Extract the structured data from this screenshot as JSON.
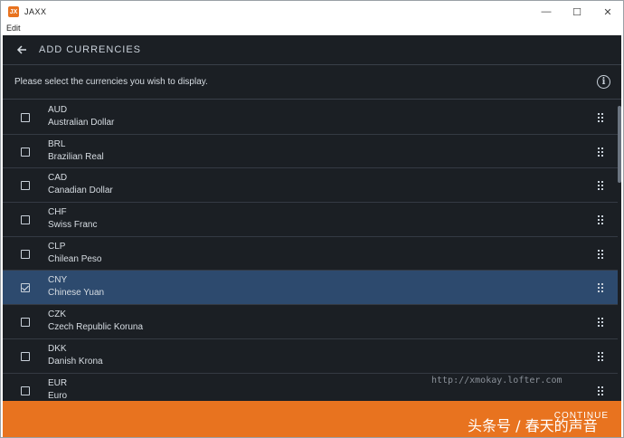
{
  "window": {
    "logo_text": "JX",
    "title": "JAXX",
    "minimize": "—",
    "maximize": "☐",
    "close": "✕"
  },
  "menu": {
    "edit": "Edit"
  },
  "header": {
    "title": "ADD CURRENCIES"
  },
  "instruction": {
    "text": "Please select the currencies you wish to display.",
    "info": "i"
  },
  "currencies": [
    {
      "code": "AUD",
      "name": "Australian Dollar",
      "checked": false
    },
    {
      "code": "BRL",
      "name": "Brazilian Real",
      "checked": false
    },
    {
      "code": "CAD",
      "name": "Canadian Dollar",
      "checked": false
    },
    {
      "code": "CHF",
      "name": "Swiss Franc",
      "checked": false
    },
    {
      "code": "CLP",
      "name": "Chilean Peso",
      "checked": false
    },
    {
      "code": "CNY",
      "name": "Chinese Yuan",
      "checked": true
    },
    {
      "code": "CZK",
      "name": "Czech Republic Koruna",
      "checked": false
    },
    {
      "code": "DKK",
      "name": "Danish Krona",
      "checked": false
    },
    {
      "code": "EUR",
      "name": "Euro",
      "checked": false
    }
  ],
  "footer": {
    "continue_label": "CONTINUE"
  },
  "watermark": {
    "url": "http://xmokay.lofter.com",
    "cn": "头条号 / 春天的声音"
  },
  "colors": {
    "accent": "#e8731f",
    "background": "#1b1f24",
    "selected": "#2d4a6e"
  },
  "icons": {
    "back": "arrow-left-icon",
    "info": "info-icon",
    "drag": "drag-handle-icon",
    "checkbox": "checkbox-icon"
  }
}
